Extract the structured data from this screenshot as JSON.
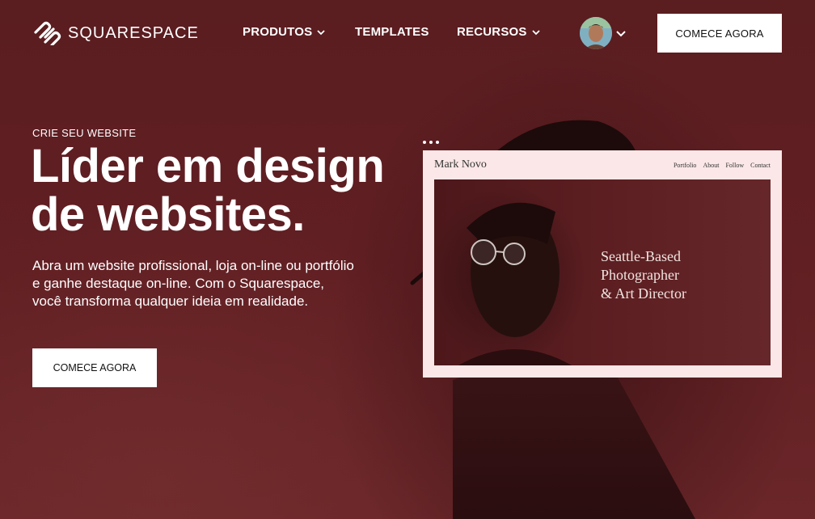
{
  "nav": {
    "brand": "SQUARESPACE",
    "items": [
      {
        "label": "PRODUTOS",
        "has_dropdown": true
      },
      {
        "label": "TEMPLATES",
        "has_dropdown": false
      },
      {
        "label": "RECURSOS",
        "has_dropdown": true
      }
    ],
    "cta_label": "COMECE AGORA"
  },
  "hero": {
    "eyebrow": "CRIE SEU WEBSITE",
    "headline_line1": "Líder em design",
    "headline_line2": "de websites.",
    "subtext": "Abra um website profissional, loja on-line ou portfólio e ganhe destaque on-line. Com o Squarespace, você transforma qualquer ideia em realidade.",
    "cta_label": "COMECE AGORA"
  },
  "template_card": {
    "site_name": "Mark Novo",
    "links": [
      "Portfolio",
      "About",
      "Follow",
      "Contact"
    ],
    "tagline_line1": "Seattle-Based",
    "tagline_line2": "Photographer",
    "tagline_line3": "& Art Director"
  },
  "colors": {
    "background": "#5e1f22",
    "card_background": "#fbe7e7",
    "button_background": "#ffffff"
  }
}
